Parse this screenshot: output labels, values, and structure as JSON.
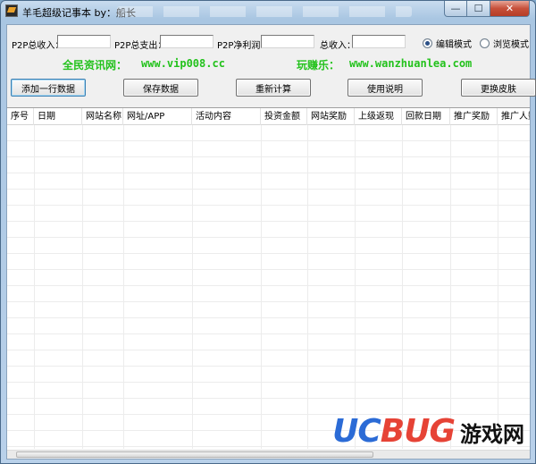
{
  "window": {
    "title": "羊毛超级记事本  by：船长",
    "min_glyph": "—",
    "max_glyph": "☐",
    "close_glyph": "✕"
  },
  "inputs": {
    "p2p_income_label": "P2P总收入：",
    "p2p_expense_label": "P2P总支出：",
    "p2p_profit_label": "P2P净利润：",
    "total_income_label": "总收入：",
    "p2p_income_value": "",
    "p2p_expense_value": "",
    "p2p_profit_value": "",
    "total_income_value": ""
  },
  "mode": {
    "edit_label": "编辑模式",
    "browse_label": "浏览模式",
    "selected": "edit"
  },
  "promo": {
    "left_name": "全民资讯网：",
    "left_url": "www.vip008.cc",
    "right_name": "玩赚乐：",
    "right_url": "www.wanzhuanlea.com"
  },
  "buttons": {
    "add_row": "添加一行数据",
    "save": "保存数据",
    "recalc": "重新计算",
    "help": "使用说明",
    "skin": "更换皮肤"
  },
  "table": {
    "columns": [
      "序号",
      "日期",
      "网站名称",
      "网址/APP",
      "活动内容",
      "投资金额",
      "网站奖励",
      "上级返现",
      "回款日期",
      "推广奖励",
      "推广人数"
    ]
  },
  "watermark": {
    "uc": "UC",
    "bug": "BUG",
    "cn": "游戏网",
    "colors": {
      "uc": "#2b6bd6",
      "bug": "#e64336"
    }
  },
  "colors": {
    "promo_green": "#23c21c",
    "titlebar": "#b9d1ea",
    "close_button": "#c7503a"
  }
}
